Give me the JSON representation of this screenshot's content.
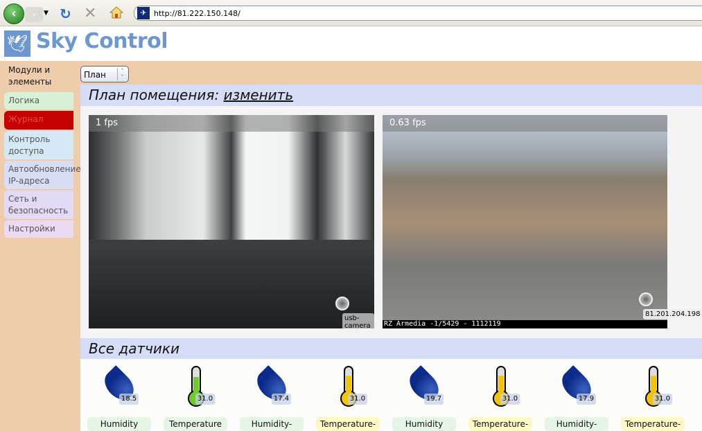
{
  "browser": {
    "url": "http://81.222.150.148/"
  },
  "logo": {
    "text": "Sky Control"
  },
  "sidebar": {
    "items": [
      {
        "label": "Модули и элементы",
        "bg": "#efcdac",
        "color": "#111"
      },
      {
        "label": "Логика",
        "bg": "#d8f2d8",
        "color": "#555"
      },
      {
        "label": "Журнал",
        "bg": "#c40000",
        "color": "#e05050"
      },
      {
        "label": "Контроль доступа",
        "bg": "#d4e8f6",
        "color": "#555"
      },
      {
        "label": "Автообновление IP-адреса",
        "bg": "#d8def6",
        "color": "#555"
      },
      {
        "label": "Сеть и безопасность",
        "bg": "#e2daf6",
        "color": "#555"
      },
      {
        "label": "Настройки",
        "bg": "#ecdaf2",
        "color": "#555"
      }
    ]
  },
  "view_select": {
    "value": "План"
  },
  "plan": {
    "title": "План помещения:",
    "edit_link": "изменить"
  },
  "cameras": [
    {
      "fps": "1 fps",
      "name": "usb-camera"
    },
    {
      "fps": "0.63 fps",
      "name": "81.201.204.198",
      "overlay": "RZ Armedia -1/5429 - 1112119"
    }
  ],
  "sensors_section": {
    "title": "Все датчики"
  },
  "sensors": [
    {
      "type": "humidity",
      "value": "18.5",
      "label": "Humidity",
      "label_bg": "#e6f4e6"
    },
    {
      "type": "temperature",
      "value": "31.0",
      "label": "Temperature",
      "label_bg": "#e6f4e6",
      "fill": "#6ccc2a",
      "level": 0.7
    },
    {
      "type": "humidity",
      "value": "17.4",
      "label": "Humidity-",
      "label_bg": "#e6f4e6"
    },
    {
      "type": "temperature",
      "value": "31.0",
      "label": "Temperature-",
      "label_bg": "#fdf8c4",
      "fill": "#f5c400",
      "level": 0.75
    },
    {
      "type": "humidity",
      "value": "19.7",
      "label": "Humidity",
      "label_bg": "#e6f4e6"
    },
    {
      "type": "temperature",
      "value": "31.0",
      "label": "Temperature-",
      "label_bg": "#fdf8c4",
      "fill": "#f5c400",
      "level": 0.75
    },
    {
      "type": "humidity",
      "value": "17.9",
      "label": "Humidity-",
      "label_bg": "#e6f4e6"
    },
    {
      "type": "temperature",
      "value": "31.0",
      "label": "Temperature-",
      "label_bg": "#fdf8c4",
      "fill": "#f5c400",
      "level": 0.75
    }
  ]
}
